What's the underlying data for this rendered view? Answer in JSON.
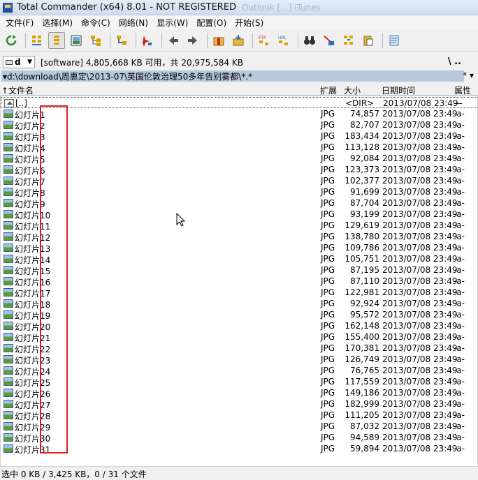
{
  "window": {
    "title": "Total Commander (x64) 8.01 - NOT REGISTERED",
    "ghost_title": "Outlook [...] iTunes"
  },
  "menu": [
    "文件(F)",
    "选择(M)",
    "命令(C)",
    "网络(N)",
    "显示(W)",
    "配置(O)",
    "开始(S)"
  ],
  "drive": {
    "letter": "d",
    "info": "[software]  4,805,668 KB 可用，共 20,975,584 KB",
    "nav": "\\    .."
  },
  "path": {
    "value": "▾d:\\download\\周惠定\\2013-07\\英国伦敦治理50多年告别雾都\\*.*",
    "right": "*  ▾"
  },
  "columns": {
    "name": "↑文件名",
    "ext": "扩展",
    "size": "大小",
    "date": "日期时间",
    "attr": "属性"
  },
  "parent_row": {
    "name": "[..]",
    "size": "<DIR>",
    "date": "2013/07/08 23:49",
    "attr": "—"
  },
  "files": [
    {
      "name": "幻灯片1",
      "ext": "JPG",
      "size": "74,857",
      "date": "2013/07/08 23:49",
      "attr": "-a-"
    },
    {
      "name": "幻灯片2",
      "ext": "JPG",
      "size": "82,707",
      "date": "2013/07/08 23:49",
      "attr": "-a-"
    },
    {
      "name": "幻灯片3",
      "ext": "JPG",
      "size": "183,434",
      "date": "2013/07/08 23:49",
      "attr": "-a-"
    },
    {
      "name": "幻灯片4",
      "ext": "JPG",
      "size": "113,128",
      "date": "2013/07/08 23:49",
      "attr": "-a-"
    },
    {
      "name": "幻灯片5",
      "ext": "JPG",
      "size": "92,084",
      "date": "2013/07/08 23:49",
      "attr": "-a-"
    },
    {
      "name": "幻灯片6",
      "ext": "JPG",
      "size": "123,373",
      "date": "2013/07/08 23:49",
      "attr": "-a-"
    },
    {
      "name": "幻灯片7",
      "ext": "JPG",
      "size": "102,377",
      "date": "2013/07/08 23:49",
      "attr": "-a-"
    },
    {
      "name": "幻灯片8",
      "ext": "JPG",
      "size": "91,699",
      "date": "2013/07/08 23:49",
      "attr": "-a-"
    },
    {
      "name": "幻灯片9",
      "ext": "JPG",
      "size": "87,704",
      "date": "2013/07/08 23:49",
      "attr": "-a-"
    },
    {
      "name": "幻灯片10",
      "ext": "JPG",
      "size": "93,199",
      "date": "2013/07/08 23:49",
      "attr": "-a-"
    },
    {
      "name": "幻灯片11",
      "ext": "JPG",
      "size": "129,619",
      "date": "2013/07/08 23:49",
      "attr": "-a-"
    },
    {
      "name": "幻灯片12",
      "ext": "JPG",
      "size": "138,780",
      "date": "2013/07/08 23:49",
      "attr": "-a-"
    },
    {
      "name": "幻灯片13",
      "ext": "JPG",
      "size": "109,786",
      "date": "2013/07/08 23:49",
      "attr": "-a-"
    },
    {
      "name": "幻灯片14",
      "ext": "JPG",
      "size": "105,751",
      "date": "2013/07/08 23:49",
      "attr": "-a-"
    },
    {
      "name": "幻灯片15",
      "ext": "JPG",
      "size": "87,195",
      "date": "2013/07/08 23:49",
      "attr": "-a-"
    },
    {
      "name": "幻灯片16",
      "ext": "JPG",
      "size": "87,110",
      "date": "2013/07/08 23:49",
      "attr": "-a-"
    },
    {
      "name": "幻灯片17",
      "ext": "JPG",
      "size": "122,981",
      "date": "2013/07/08 23:49",
      "attr": "-a-"
    },
    {
      "name": "幻灯片18",
      "ext": "JPG",
      "size": "92,924",
      "date": "2013/07/08 23:49",
      "attr": "-a-"
    },
    {
      "name": "幻灯片19",
      "ext": "JPG",
      "size": "95,572",
      "date": "2013/07/08 23:49",
      "attr": "-a-"
    },
    {
      "name": "幻灯片20",
      "ext": "JPG",
      "size": "162,148",
      "date": "2013/07/08 23:49",
      "attr": "-a-"
    },
    {
      "name": "幻灯片21",
      "ext": "JPG",
      "size": "155,400",
      "date": "2013/07/08 23:49",
      "attr": "-a-"
    },
    {
      "name": "幻灯片22",
      "ext": "JPG",
      "size": "170,381",
      "date": "2013/07/08 23:49",
      "attr": "-a-"
    },
    {
      "name": "幻灯片23",
      "ext": "JPG",
      "size": "126,749",
      "date": "2013/07/08 23:49",
      "attr": "-a-"
    },
    {
      "name": "幻灯片24",
      "ext": "JPG",
      "size": "76,765",
      "date": "2013/07/08 23:49",
      "attr": "-a-"
    },
    {
      "name": "幻灯片25",
      "ext": "JPG",
      "size": "117,559",
      "date": "2013/07/08 23:49",
      "attr": "-a-"
    },
    {
      "name": "幻灯片26",
      "ext": "JPG",
      "size": "149,186",
      "date": "2013/07/08 23:49",
      "attr": "-a-"
    },
    {
      "name": "幻灯片27",
      "ext": "JPG",
      "size": "182,999",
      "date": "2013/07/08 23:49",
      "attr": "-a-"
    },
    {
      "name": "幻灯片28",
      "ext": "JPG",
      "size": "111,205",
      "date": "2013/07/08 23:49",
      "attr": "-a-"
    },
    {
      "name": "幻灯片29",
      "ext": "JPG",
      "size": "87,032",
      "date": "2013/07/08 23:49",
      "attr": "-a-"
    },
    {
      "name": "幻灯片30",
      "ext": "JPG",
      "size": "94,589",
      "date": "2013/07/08 23:49",
      "attr": "-a-"
    },
    {
      "name": "幻灯片31",
      "ext": "JPG",
      "size": "59,894",
      "date": "2013/07/08 23:49",
      "attr": "-a-"
    }
  ],
  "status": "选中 0 KB / 3,425 KB，0 / 31 个文件",
  "colors": {
    "path_bg": "#b7c9db",
    "highlight_box": "#e01d1d"
  }
}
